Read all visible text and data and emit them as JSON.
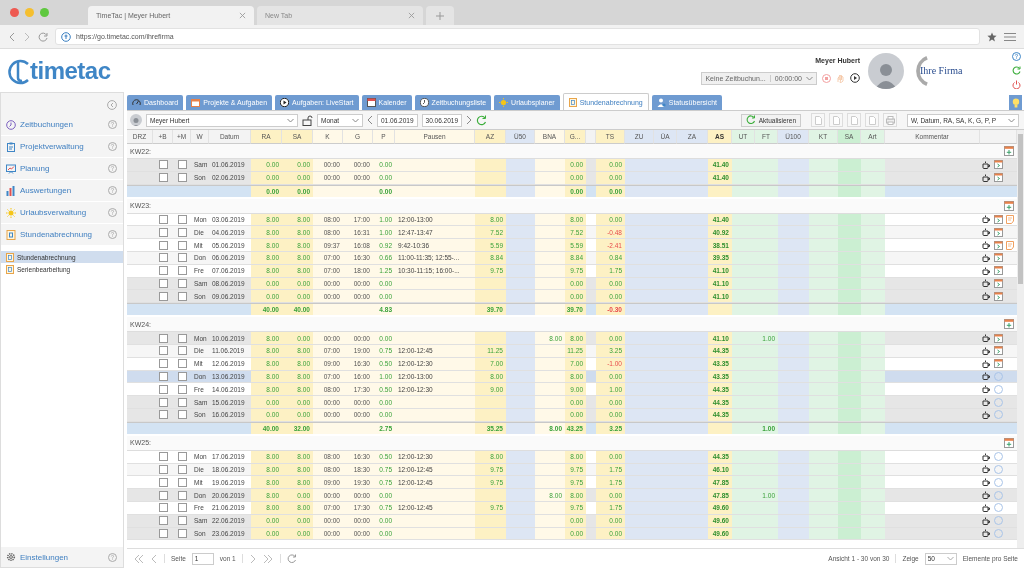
{
  "browser": {
    "tabs": [
      {
        "label": "TimeTac | Meyer Hubert",
        "selected": true
      },
      {
        "label": "New Tab",
        "selected": false
      }
    ],
    "url": "https://go.timetac.com/ihrefirma"
  },
  "header": {
    "logo": "timetac",
    "user_name": "Meyer Hubert",
    "company_logo": "Ihre Firma",
    "timer_task": "Keine Zeitbuchun...",
    "timer_time": "00:00:00"
  },
  "sidebar": {
    "items": [
      {
        "label": "Zeitbuchungen"
      },
      {
        "label": "Projektverwaltung"
      },
      {
        "label": "Planung"
      },
      {
        "label": "Auswertungen"
      },
      {
        "label": "Urlaubsverwaltung"
      },
      {
        "label": "Stundenabrechnung"
      }
    ],
    "sub_items": [
      {
        "label": "Stundenabrechnung",
        "selected": true
      },
      {
        "label": "Serienbearbeitung",
        "selected": false
      }
    ],
    "settings": "Einstellungen"
  },
  "nav_tabs": [
    {
      "label": "Dashboard",
      "selected": false
    },
    {
      "label": "Projekte & Aufgaben",
      "selected": false
    },
    {
      "label": "Aufgaben: LiveStart",
      "selected": false
    },
    {
      "label": "Kalender",
      "selected": false
    },
    {
      "label": "Zeitbuchungsliste",
      "selected": false
    },
    {
      "label": "Urlaubsplaner",
      "selected": false
    },
    {
      "label": "Stundenabrechnung",
      "selected": true
    },
    {
      "label": "Statusübersicht",
      "selected": false
    }
  ],
  "toolbar": {
    "employee": "Meyer Hubert",
    "period": "Monat",
    "date_from": "01.06.2019",
    "date_to": "30.06.2019",
    "refresh_button": "Aktualisieren",
    "columns_select": "W, Datum, RA, SA, K, G, P, P"
  },
  "table": {
    "columns": [
      {
        "label": "DRZ",
        "kind": "plain"
      },
      {
        "label": "+B",
        "kind": "plain"
      },
      {
        "label": "+M",
        "kind": "plain"
      },
      {
        "label": "W",
        "kind": "plain"
      },
      {
        "label": "Datum",
        "kind": "plain"
      },
      {
        "label": "RA",
        "kind": "yellow"
      },
      {
        "label": "SA",
        "kind": "yellow"
      },
      {
        "label": "K",
        "kind": "cream"
      },
      {
        "label": "G",
        "kind": "cream"
      },
      {
        "label": "P",
        "kind": "cream"
      },
      {
        "label": "Pausen",
        "kind": "cream"
      },
      {
        "label": "AZ",
        "kind": "yellow"
      },
      {
        "label": "Ü50",
        "kind": "blue"
      },
      {
        "label": "BNA",
        "kind": "cream"
      },
      {
        "label": "G...",
        "kind": "yellow"
      },
      {
        "kind": "plain"
      },
      {
        "label": "TS",
        "kind": "yellow"
      },
      {
        "label": "ZU",
        "kind": "blue"
      },
      {
        "label": "ÜA",
        "kind": "blue"
      },
      {
        "label": "ZA",
        "kind": "blue"
      },
      {
        "label": "AS",
        "kind": "yellow"
      },
      {
        "label": "UT",
        "kind": "mint"
      },
      {
        "label": "FT",
        "kind": "mint"
      },
      {
        "label": "Ü100",
        "kind": "blue"
      },
      {
        "label": "KT",
        "kind": "mint"
      },
      {
        "label": "SA",
        "kind": "green"
      },
      {
        "label": "Art",
        "kind": "mint"
      },
      {
        "label": "Kommentar",
        "kind": "plain"
      },
      {
        "kind": "plain"
      }
    ],
    "weeks": [
      {
        "label": "KW22:",
        "rows": [
          {
            "weekday": "Sam",
            "date": "01.06.2019",
            "plus_b": false,
            "plus_m": false,
            "selected": false,
            "day_off": true,
            "ts_negative": false,
            "confirmed": true,
            "note": false,
            "values": {
              "ra": "0.00",
              "sa": "0.00",
              "k": "00:00",
              "g": "00:00",
              "p": "0.00",
              "gx": "0.00",
              "ts": "0.00",
              "as": "41.40"
            }
          },
          {
            "weekday": "Son",
            "date": "02.06.2019",
            "plus_b": false,
            "plus_m": false,
            "selected": false,
            "day_off": true,
            "ts_negative": false,
            "confirmed": true,
            "note": false,
            "values": {
              "ra": "0.00",
              "sa": "0.00",
              "k": "00:00",
              "g": "00:00",
              "p": "0.00",
              "gx": "0.00",
              "ts": "0.00",
              "as": "41.40"
            }
          }
        ],
        "totals": {
          "ts_negative": false,
          "values": {
            "ra": "0.00",
            "sa": "0.00",
            "p": "0.00",
            "gx": "0.00",
            "ts": "0.00"
          }
        }
      },
      {
        "label": "KW23:",
        "rows": [
          {
            "weekday": "Mon",
            "date": "03.06.2019",
            "plus_b": false,
            "plus_m": false,
            "selected": false,
            "day_off": false,
            "ts_negative": false,
            "confirmed": true,
            "note": true,
            "values": {
              "ra": "8.00",
              "sa": "8.00",
              "k": "08:00",
              "g": "17:00",
              "p": "1.00",
              "pausen": "12:00-13:00",
              "az": "8.00",
              "gx": "8.00",
              "ts": "0.00",
              "as": "41.40"
            }
          },
          {
            "weekday": "Die",
            "date": "04.06.2019",
            "plus_b": false,
            "plus_m": false,
            "selected": false,
            "day_off": false,
            "ts_negative": true,
            "confirmed": true,
            "note": false,
            "values": {
              "ra": "8.00",
              "sa": "8.00",
              "k": "08:00",
              "g": "16:31",
              "p": "1.00",
              "pausen": "12:47-13:47",
              "az": "7.52",
              "gx": "7.52",
              "ts": "-0.48",
              "as": "40.92"
            }
          },
          {
            "weekday": "Mit",
            "date": "05.06.2019",
            "plus_b": false,
            "plus_m": false,
            "selected": false,
            "day_off": false,
            "ts_negative": true,
            "confirmed": true,
            "note": true,
            "values": {
              "ra": "8.00",
              "sa": "8.00",
              "k": "09:37",
              "g": "16:08",
              "p": "0.92",
              "pausen": "9:42-10:36",
              "az": "5.59",
              "gx": "5.59",
              "ts": "-2.41",
              "as": "38.51"
            }
          },
          {
            "weekday": "Don",
            "date": "06.06.2019",
            "plus_b": false,
            "plus_m": false,
            "selected": false,
            "day_off": false,
            "ts_negative": false,
            "confirmed": true,
            "note": false,
            "values": {
              "ra": "8.00",
              "sa": "8.00",
              "k": "07:00",
              "g": "16:30",
              "p": "0.66",
              "pausen": "11:00-11:35; 12:55-...",
              "az": "8.84",
              "gx": "8.84",
              "ts": "0.84",
              "as": "39.35"
            }
          },
          {
            "weekday": "Fre",
            "date": "07.06.2019",
            "plus_b": false,
            "plus_m": false,
            "selected": false,
            "day_off": false,
            "ts_negative": false,
            "confirmed": true,
            "note": false,
            "values": {
              "ra": "8.00",
              "sa": "8.00",
              "k": "07:00",
              "g": "18:00",
              "p": "1.25",
              "pausen": "10:30-11:15; 16:00-...",
              "az": "9.75",
              "gx": "9.75",
              "ts": "1.75",
              "as": "41.10"
            }
          },
          {
            "weekday": "Sam",
            "date": "08.06.2019",
            "plus_b": false,
            "plus_m": false,
            "selected": false,
            "day_off": true,
            "ts_negative": false,
            "confirmed": true,
            "note": false,
            "values": {
              "ra": "0.00",
              "sa": "0.00",
              "k": "00:00",
              "g": "00:00",
              "p": "0.00",
              "gx": "0.00",
              "ts": "0.00",
              "as": "41.10"
            }
          },
          {
            "weekday": "Son",
            "date": "09.06.2019",
            "plus_b": false,
            "plus_m": false,
            "selected": false,
            "day_off": true,
            "ts_negative": false,
            "confirmed": true,
            "note": false,
            "values": {
              "ra": "0.00",
              "sa": "0.00",
              "k": "00:00",
              "g": "00:00",
              "p": "0.00",
              "gx": "0.00",
              "ts": "0.00",
              "as": "41.10"
            }
          }
        ],
        "totals": {
          "ts_negative": true,
          "values": {
            "ra": "40.00",
            "sa": "40.00",
            "p": "4.83",
            "az": "39.70",
            "gx": "39.70",
            "ts": "-0.30"
          }
        }
      },
      {
        "label": "KW24:",
        "rows": [
          {
            "weekday": "Mon",
            "date": "10.06.2019",
            "plus_b": false,
            "plus_m": false,
            "selected": false,
            "day_off": true,
            "ts_negative": false,
            "confirmed": true,
            "note": false,
            "values": {
              "ra": "8.00",
              "sa": "0.00",
              "k": "00:00",
              "g": "00:00",
              "p": "0.00",
              "bna": "8.00",
              "gx": "8.00",
              "ts": "0.00",
              "as": "41.10",
              "ft": "1.00"
            }
          },
          {
            "weekday": "Die",
            "date": "11.06.2019",
            "plus_b": false,
            "plus_m": false,
            "selected": false,
            "day_off": false,
            "ts_negative": false,
            "confirmed": true,
            "note": false,
            "values": {
              "ra": "8.00",
              "sa": "8.00",
              "k": "07:00",
              "g": "19:00",
              "p": "0.75",
              "pausen": "12:00-12:45",
              "az": "11.25",
              "gx": "11.25",
              "ts": "3.25",
              "as": "44.35"
            }
          },
          {
            "weekday": "Mit",
            "date": "12.06.2019",
            "plus_b": false,
            "plus_m": false,
            "selected": false,
            "day_off": false,
            "ts_negative": true,
            "confirmed": true,
            "note": false,
            "values": {
              "ra": "8.00",
              "sa": "8.00",
              "k": "09:00",
              "g": "16:30",
              "p": "0.50",
              "pausen": "12:00-12:30",
              "az": "7.00",
              "gx": "7.00",
              "ts": "-1.00",
              "as": "43.35"
            }
          },
          {
            "weekday": "Don",
            "date": "13.06.2019",
            "plus_b": false,
            "plus_m": false,
            "selected": true,
            "day_off": false,
            "ts_negative": false,
            "confirmed": false,
            "note": false,
            "values": {
              "ra": "8.00",
              "sa": "8.00",
              "k": "07:00",
              "g": "16:00",
              "p": "1.00",
              "pausen": "12:00-13:00",
              "az": "8.00",
              "gx": "8.00",
              "ts": "0.00",
              "as": "43.35"
            }
          },
          {
            "weekday": "Fre",
            "date": "14.06.2019",
            "plus_b": false,
            "plus_m": false,
            "selected": false,
            "day_off": false,
            "ts_negative": false,
            "confirmed": false,
            "note": false,
            "values": {
              "ra": "8.00",
              "sa": "8.00",
              "k": "08:00",
              "g": "17:30",
              "p": "0.50",
              "pausen": "12:00-12:30",
              "az": "9.00",
              "gx": "9.00",
              "ts": "1.00",
              "as": "44.35"
            }
          },
          {
            "weekday": "Sam",
            "date": "15.06.2019",
            "plus_b": false,
            "plus_m": false,
            "selected": false,
            "day_off": true,
            "ts_negative": false,
            "confirmed": false,
            "note": false,
            "values": {
              "ra": "0.00",
              "sa": "0.00",
              "k": "00:00",
              "g": "00:00",
              "p": "0.00",
              "gx": "0.00",
              "ts": "0.00",
              "as": "44.35"
            }
          },
          {
            "weekday": "Son",
            "date": "16.06.2019",
            "plus_b": false,
            "plus_m": false,
            "selected": false,
            "day_off": true,
            "ts_negative": false,
            "confirmed": false,
            "note": false,
            "values": {
              "ra": "0.00",
              "sa": "0.00",
              "k": "00:00",
              "g": "00:00",
              "p": "0.00",
              "gx": "0.00",
              "ts": "0.00",
              "as": "44.35"
            }
          }
        ],
        "totals": {
          "ts_negative": false,
          "values": {
            "ra": "40.00",
            "sa": "32.00",
            "p": "2.75",
            "az": "35.25",
            "bna": "8.00",
            "gx": "43.25",
            "ts": "3.25",
            "ft": "1.00"
          }
        }
      },
      {
        "label": "KW25:",
        "rows": [
          {
            "weekday": "Mon",
            "date": "17.06.2019",
            "plus_b": false,
            "plus_m": false,
            "selected": false,
            "day_off": false,
            "ts_negative": false,
            "confirmed": false,
            "note": false,
            "values": {
              "ra": "8.00",
              "sa": "8.00",
              "k": "08:00",
              "g": "16:30",
              "p": "0.50",
              "pausen": "12:00-12:30",
              "az": "8.00",
              "gx": "8.00",
              "ts": "0.00",
              "as": "44.35"
            }
          },
          {
            "weekday": "Die",
            "date": "18.06.2019",
            "plus_b": false,
            "plus_m": false,
            "selected": false,
            "day_off": false,
            "ts_negative": false,
            "confirmed": false,
            "note": false,
            "values": {
              "ra": "8.00",
              "sa": "8.00",
              "k": "08:00",
              "g": "18:30",
              "p": "0.75",
              "pausen": "12:00-12:45",
              "az": "9.75",
              "gx": "9.75",
              "ts": "1.75",
              "as": "46.10"
            }
          },
          {
            "weekday": "Mit",
            "date": "19.06.2019",
            "plus_b": false,
            "plus_m": false,
            "selected": false,
            "day_off": false,
            "ts_negative": false,
            "confirmed": false,
            "note": false,
            "values": {
              "ra": "8.00",
              "sa": "8.00",
              "k": "09:00",
              "g": "19:30",
              "p": "0.75",
              "pausen": "12:00-12:45",
              "az": "9.75",
              "gx": "9.75",
              "ts": "1.75",
              "as": "47.85"
            }
          },
          {
            "weekday": "Don",
            "date": "20.06.2019",
            "plus_b": false,
            "plus_m": false,
            "selected": false,
            "day_off": true,
            "ts_negative": false,
            "confirmed": false,
            "note": false,
            "values": {
              "ra": "8.00",
              "sa": "0.00",
              "k": "00:00",
              "g": "00:00",
              "p": "0.00",
              "bna": "8.00",
              "gx": "8.00",
              "ts": "0.00",
              "as": "47.85",
              "ft": "1.00"
            }
          },
          {
            "weekday": "Fre",
            "date": "21.06.2019",
            "plus_b": false,
            "plus_m": false,
            "selected": false,
            "day_off": false,
            "ts_negative": false,
            "confirmed": false,
            "note": false,
            "values": {
              "ra": "8.00",
              "sa": "8.00",
              "k": "07:00",
              "g": "17:30",
              "p": "0.75",
              "pausen": "12:00-12:45",
              "az": "9.75",
              "gx": "9.75",
              "ts": "1.75",
              "as": "49.60"
            }
          },
          {
            "weekday": "Sam",
            "date": "22.06.2019",
            "plus_b": false,
            "plus_m": false,
            "selected": false,
            "day_off": true,
            "ts_negative": false,
            "confirmed": false,
            "note": false,
            "values": {
              "ra": "0.00",
              "sa": "0.00",
              "k": "00:00",
              "g": "00:00",
              "p": "0.00",
              "gx": "0.00",
              "ts": "0.00",
              "as": "49.60"
            }
          },
          {
            "weekday": "Son",
            "date": "23.06.2019",
            "plus_b": false,
            "plus_m": false,
            "selected": false,
            "day_off": true,
            "ts_negative": false,
            "confirmed": false,
            "note": false,
            "values": {
              "ra": "0.00",
              "sa": "0.00",
              "k": "00:00",
              "g": "00:00",
              "p": "0.00",
              "gx": "0.00",
              "ts": "0.00",
              "as": "49.60"
            }
          }
        ]
      }
    ]
  },
  "footer": {
    "page_label": "Seite",
    "page": "1",
    "page_total": "von 1",
    "range": "Ansicht 1 - 30 von 30",
    "show_label": "Zeige",
    "page_size": "50",
    "per_page_label": "Elemente pro Seite"
  }
}
